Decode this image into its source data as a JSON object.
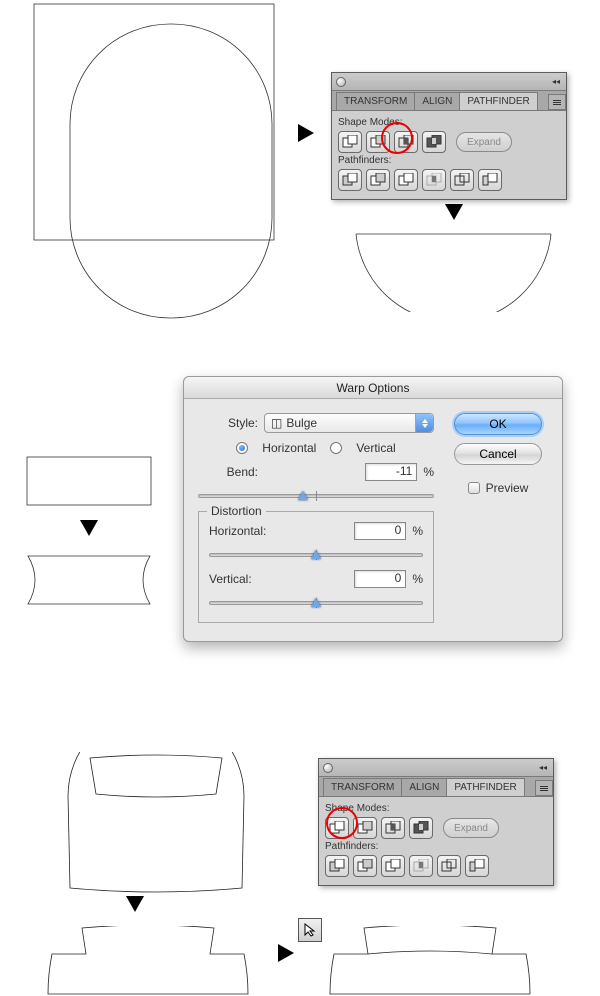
{
  "pathfinder_panel": {
    "tabs": [
      "TRANSFORM",
      "ALIGN",
      "PATHFINDER"
    ],
    "active_tab": "PATHFINDER",
    "shape_modes_label": "Shape Modes:",
    "pathfinders_label": "Pathfinders:",
    "expand_label": "Expand",
    "shape_mode_buttons": [
      "unite",
      "minus-front",
      "intersect",
      "exclude"
    ],
    "pathfinder_buttons": [
      "divide",
      "trim",
      "merge",
      "crop",
      "outline",
      "minus-back"
    ]
  },
  "warp_dialog": {
    "title": "Warp Options",
    "style_label": "Style:",
    "style_value": "Bulge",
    "orientation": {
      "horizontal_label": "Horizontal",
      "vertical_label": "Vertical",
      "selected": "horizontal"
    },
    "bend_label": "Bend:",
    "bend_value": "-11",
    "percent": "%",
    "distortion_label": "Distortion",
    "dist_h_label": "Horizontal:",
    "dist_h_value": "0",
    "dist_v_label": "Vertical:",
    "dist_v_value": "0",
    "ok_label": "OK",
    "cancel_label": "Cancel",
    "preview_label": "Preview"
  }
}
